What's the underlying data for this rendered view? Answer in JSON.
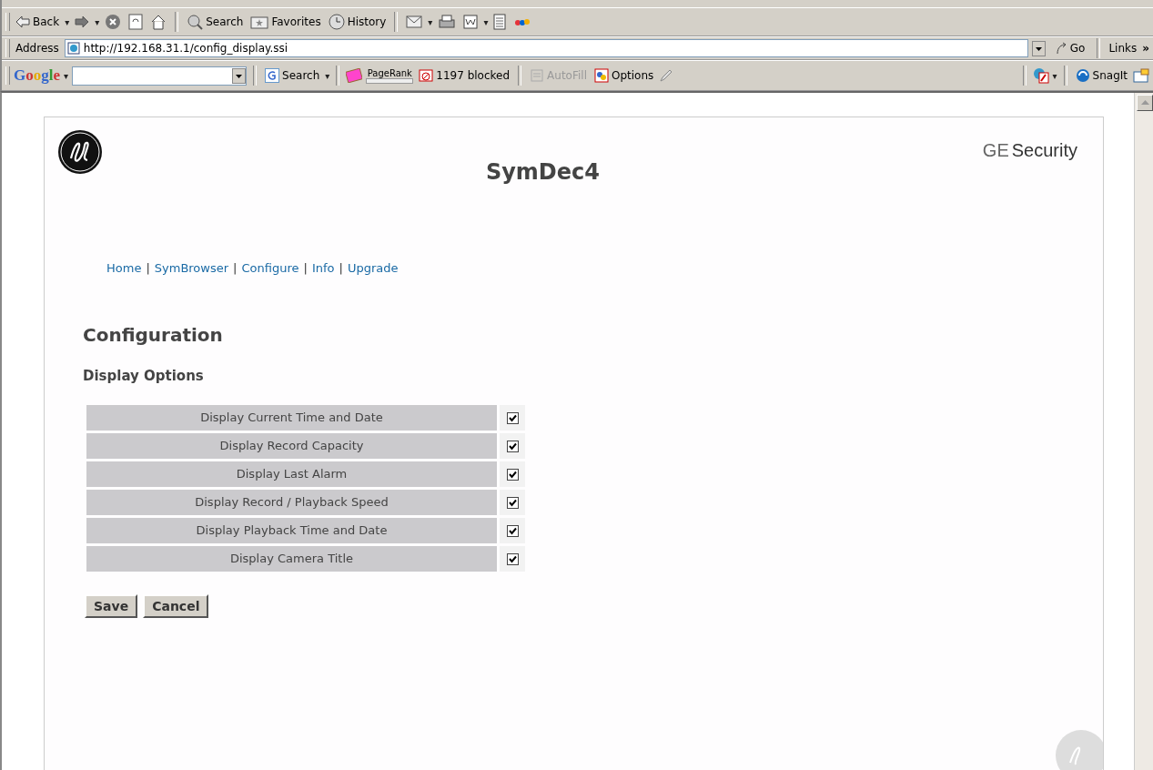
{
  "toolbar": {
    "buttons": [
      {
        "kind": "back",
        "label": "Back",
        "caret": "▾"
      },
      {
        "kind": "forward",
        "caret": "▾"
      },
      {
        "kind": "stop"
      },
      {
        "kind": "refresh"
      },
      {
        "kind": "home"
      },
      {
        "kind": "sep"
      },
      {
        "kind": "search",
        "label": "Search"
      },
      {
        "kind": "favorites",
        "label": "Favorites"
      },
      {
        "kind": "history",
        "label": "History"
      },
      {
        "kind": "sep"
      },
      {
        "kind": "mail",
        "caret": "▾"
      },
      {
        "kind": "print"
      },
      {
        "kind": "word",
        "caret": "▾"
      },
      {
        "kind": "page"
      },
      {
        "kind": "ebay"
      }
    ]
  },
  "address_bar": {
    "label": "Address",
    "url": "http://192.168.31.1/config_display.ssi",
    "go": "Go",
    "links": "Links",
    "more": "»"
  },
  "google_bar": {
    "logo": "Google",
    "caret": "▾",
    "search": "Search",
    "search_caret": "▾",
    "pagerank": "PageRank",
    "blocked": "1197 blocked",
    "autofill": "AutoFill",
    "options": "Options",
    "pdf_caret": "▾",
    "snagit": "SnagIt"
  },
  "page": {
    "title": "SymDec4",
    "brand_prefix": "GE",
    "brand": "Security",
    "nav": [
      {
        "label": "Home"
      },
      {
        "label": "SymBrowser"
      },
      {
        "label": "Configure"
      },
      {
        "label": "Info"
      },
      {
        "label": "Upgrade"
      }
    ],
    "nav_separator": "|",
    "heading": "Configuration",
    "subheading": "Display Options",
    "options": [
      {
        "label": "Display Current Time and Date",
        "checked": true
      },
      {
        "label": "Display Record Capacity",
        "checked": true
      },
      {
        "label": "Display Last Alarm",
        "checked": true
      },
      {
        "label": "Display Record / Playback Speed",
        "checked": true
      },
      {
        "label": "Display Playback Time and Date",
        "checked": true
      },
      {
        "label": "Display Camera Title",
        "checked": true
      }
    ],
    "buttons": [
      "Save",
      "Cancel"
    ]
  }
}
